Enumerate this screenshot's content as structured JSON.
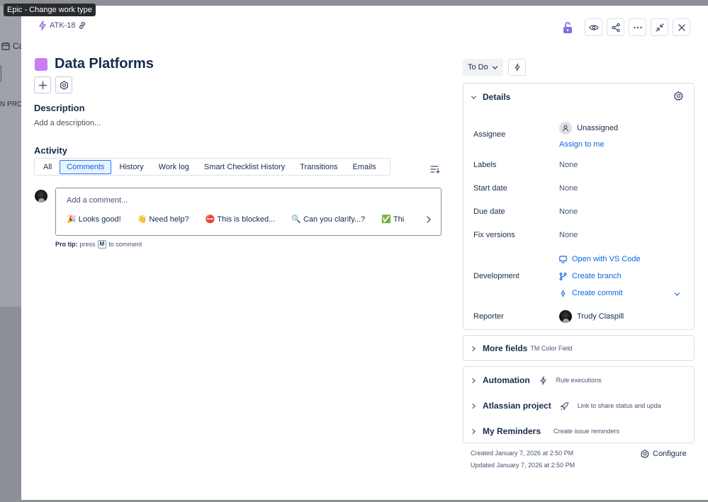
{
  "tooltip": "Epic - Change work type",
  "background": {
    "calendar_text": "Ca",
    "column_label": "N PROG"
  },
  "issue": {
    "key": "ATK-18",
    "title": "Data Platforms",
    "swatch_color": "#c97cf4",
    "description_heading": "Description",
    "description_placeholder": "Add a description..."
  },
  "header_icons": [
    "lock-icon",
    "watch-icon",
    "share-icon",
    "more-icon",
    "minimize-icon",
    "close-icon"
  ],
  "activity": {
    "heading": "Activity",
    "tabs": [
      "All",
      "Comments",
      "History",
      "Work log",
      "Smart Checklist History",
      "Transitions",
      "Emails"
    ],
    "active_tab": "Comments",
    "comment_placeholder": "Add a comment...",
    "quick_replies": [
      {
        "emoji": "🎉",
        "text": "Looks good!"
      },
      {
        "emoji": "👋",
        "text": "Need help?"
      },
      {
        "emoji": "⛔",
        "text": "This is blocked..."
      },
      {
        "emoji": "🔍",
        "text": "Can you clarify...?"
      },
      {
        "emoji": "✅",
        "text": "Thi"
      }
    ],
    "pro_tip_label": "Pro tip:",
    "pro_tip_press": "press",
    "pro_tip_key": "M",
    "pro_tip_suffix": "to comment"
  },
  "status": {
    "label": "To Do"
  },
  "details": {
    "heading": "Details",
    "assignee_label": "Assignee",
    "assignee_value": "Unassigned",
    "assign_to_me": "Assign to me",
    "labels_label": "Labels",
    "labels_value": "None",
    "start_date_label": "Start date",
    "start_date_value": "None",
    "due_date_label": "Due date",
    "due_date_value": "None",
    "fix_versions_label": "Fix versions",
    "fix_versions_value": "None",
    "development_label": "Development",
    "dev_vscode": "Open with VS Code",
    "dev_branch": "Create branch",
    "dev_commit": "Create commit",
    "reporter_label": "Reporter",
    "reporter_value": "Trudy Claspill"
  },
  "more_fields": {
    "heading": "More fields",
    "note": "TM Color Field"
  },
  "automation": {
    "heading": "Automation",
    "note": "Rule executions"
  },
  "atlassian_project": {
    "heading": "Atlassian project",
    "note": "Link to share status and upda"
  },
  "reminders": {
    "heading": "My Reminders",
    "note": "Create issue reminders"
  },
  "footer": {
    "created": "Created January 7, 2026 at 2:50 PM",
    "updated": "Updated January 7, 2026 at 2:50 PM",
    "configure": "Configure"
  }
}
